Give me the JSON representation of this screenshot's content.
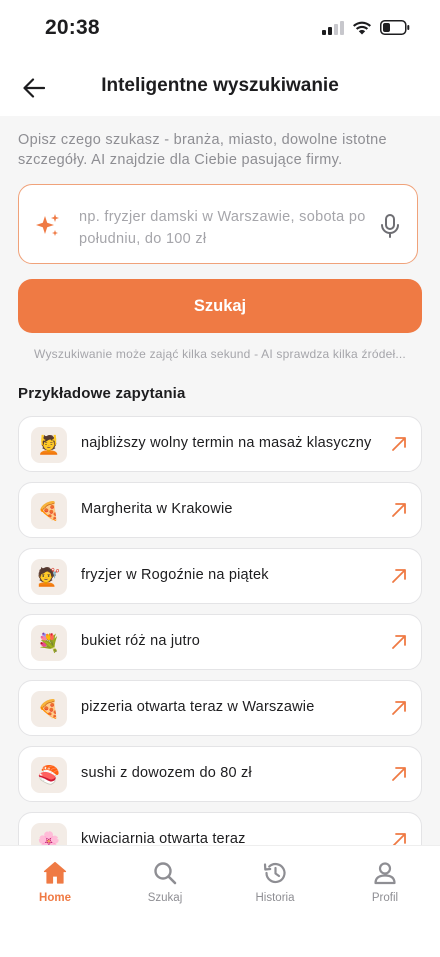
{
  "status_bar": {
    "time": "20:38"
  },
  "header": {
    "title": "Inteligentne wyszukiwanie"
  },
  "description": "Opisz czego szukasz - branża, miasto, dowolne istotne szczegóły. AI znajdzie dla Ciebie pasujące firmy.",
  "search": {
    "placeholder": "np. fryzjer damski w Warszawie, sobota po południu, do 100 zł",
    "button_label": "Szukaj",
    "hint": "Wyszukiwanie może zająć kilka sekund - AI sprawdza kilka źródeł..."
  },
  "examples": {
    "title": "Przykładowe zapytania",
    "items": [
      {
        "icon": "massage-icon",
        "emoji": "💆",
        "text": "najbliższy wolny termin na masaż klasyczny"
      },
      {
        "icon": "pizza-icon",
        "emoji": "🍕",
        "text": "Margherita w Krakowie"
      },
      {
        "icon": "hairdresser-icon",
        "emoji": "💇",
        "text": "fryzjer w Rogoźnie na piątek"
      },
      {
        "icon": "bouquet-icon",
        "emoji": "💐",
        "text": "bukiet róż na jutro"
      },
      {
        "icon": "pizza-icon",
        "emoji": "🍕",
        "text": "pizzeria otwarta teraz w Warszawie"
      },
      {
        "icon": "sushi-icon",
        "emoji": "🍣",
        "text": "sushi z dowozem do 80 zł"
      },
      {
        "icon": "flower-icon",
        "emoji": "🌸",
        "text": "kwiaciarnia otwarta teraz"
      }
    ]
  },
  "tabs": [
    {
      "label": "Home",
      "icon": "home-icon",
      "active": true
    },
    {
      "label": "Szukaj",
      "icon": "search-icon",
      "active": false
    },
    {
      "label": "Historia",
      "icon": "history-icon",
      "active": false
    },
    {
      "label": "Profil",
      "icon": "profile-icon",
      "active": false
    }
  ],
  "colors": {
    "accent": "#ef7a44",
    "background": "#f6f6f6"
  }
}
